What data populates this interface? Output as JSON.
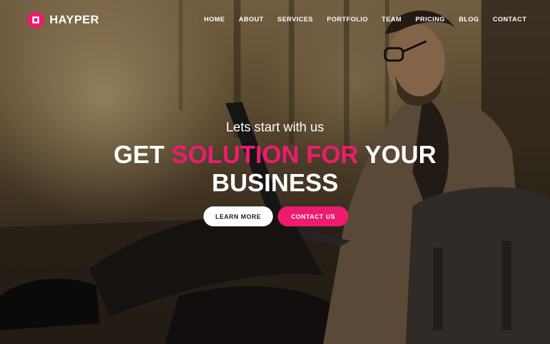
{
  "brand": {
    "name": "HAYPER",
    "accent_color": "#ee1b6e",
    "logo_icon": "hexagon-square-logo"
  },
  "nav": {
    "items": [
      {
        "label": "HOME"
      },
      {
        "label": "ABOUT"
      },
      {
        "label": "SERVICES"
      },
      {
        "label": "PORTFOLIO"
      },
      {
        "label": "TEAM"
      },
      {
        "label": "PRICING"
      },
      {
        "label": "BLOG"
      },
      {
        "label": "CONTACT"
      }
    ]
  },
  "hero": {
    "tagline": "Lets start with us",
    "headline_part1": "GET ",
    "headline_accent": "SOLUTION FOR",
    "headline_part2": " YOUR",
    "headline_line2": "BUSINESS",
    "learn_more_label": "LEARN MORE",
    "contact_label": "CONTACT US"
  }
}
